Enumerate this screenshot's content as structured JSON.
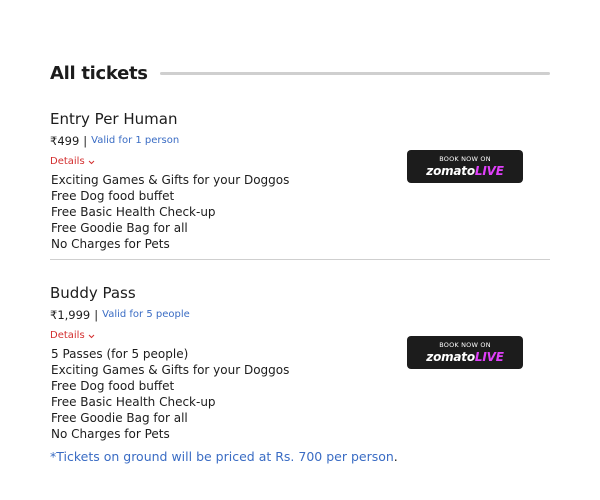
{
  "section": {
    "title": "All tickets"
  },
  "tickets": [
    {
      "name": "Entry Per Human",
      "price": "₹499",
      "separator": "|",
      "validity": "Valid for 1 person",
      "details_label": "Details",
      "perks": [
        "Exciting Games & Gifts for your Doggos",
        "Free Dog food buffet",
        "Free Basic Health Check-up",
        "Free Goodie Bag for all",
        "No Charges for Pets"
      ],
      "book": {
        "label": "BOOK NOW ON",
        "brand_a": "zomato",
        "brand_b": "LIVE"
      }
    },
    {
      "name": "Buddy Pass",
      "price": "₹1,999",
      "separator": "|",
      "validity": "Valid for 5 people",
      "details_label": "Details",
      "perks": [
        "5 Passes (for 5 people)",
        "Exciting Games & Gifts for your Doggos",
        "Free Dog food buffet",
        "Free Basic Health Check-up",
        "Free Goodie Bag for all",
        "No Charges for Pets"
      ],
      "book": {
        "label": "BOOK NOW ON",
        "brand_a": "zomato",
        "brand_b": "LIVE"
      }
    }
  ],
  "footnote": {
    "text": "*Tickets on ground will be priced at Rs. 700 per person",
    "dot": "."
  },
  "colors": {
    "accent_blue": "#3a6cc4",
    "details_red": "#d32f2f",
    "button_bg": "#1c1c1c",
    "brand_live": "#e040fb"
  },
  "icons": {
    "details_toggle": "chevron-down-icon"
  }
}
